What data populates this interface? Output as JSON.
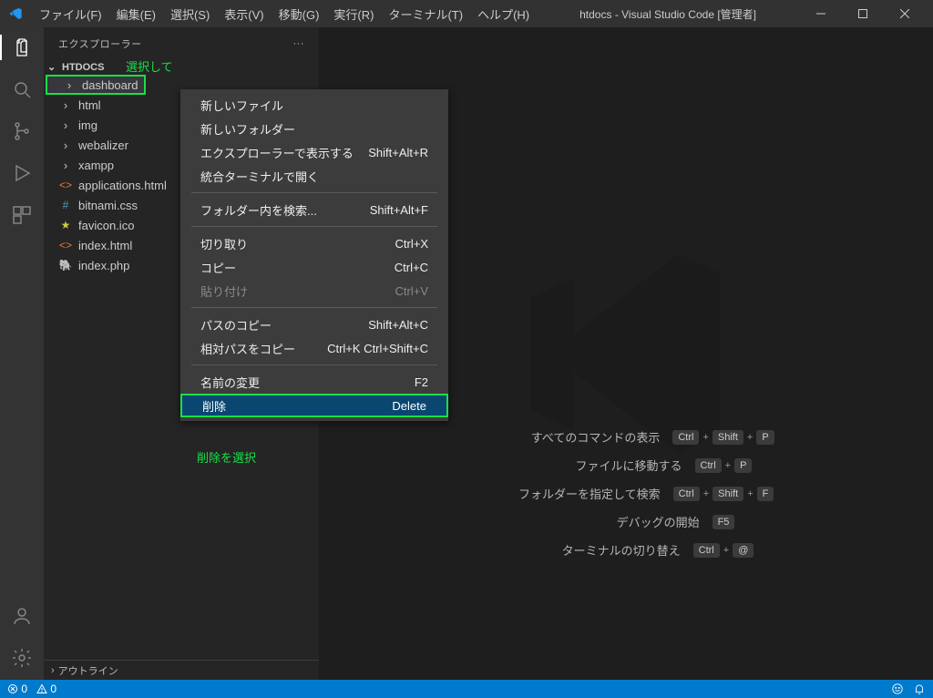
{
  "titlebar": {
    "title": "htdocs - Visual Studio Code [管理者]"
  },
  "menubar": {
    "file": "ファイル(F)",
    "edit": "編集(E)",
    "select": "選択(S)",
    "view": "表示(V)",
    "go": "移動(G)",
    "run": "実行(R)",
    "terminal": "ターミナル(T)",
    "help": "ヘルプ(H)"
  },
  "sidebar": {
    "title": "エクスプローラー",
    "project": "HTDOCS",
    "tree": {
      "dashboard": "dashboard",
      "html": "html",
      "img": "img",
      "webalizer": "webalizer",
      "xampp": "xampp",
      "applications": "applications.html",
      "bitnami": "bitnami.css",
      "favicon": "favicon.ico",
      "indexhtml": "index.html",
      "indexphp": "index.php"
    },
    "outline": "アウトライン"
  },
  "annotations": {
    "select": "選択して",
    "delete": "削除を選択"
  },
  "context": {
    "newfile": "新しいファイル",
    "newfolder": "新しいフォルダー",
    "reveal": "エクスプローラーで表示する",
    "reveal_kb": "Shift+Alt+R",
    "terminal": "統合ターミナルで開く",
    "find": "フォルダー内を検索...",
    "find_kb": "Shift+Alt+F",
    "cut": "切り取り",
    "cut_kb": "Ctrl+X",
    "copy": "コピー",
    "copy_kb": "Ctrl+C",
    "paste": "貼り付け",
    "paste_kb": "Ctrl+V",
    "copypath": "パスのコピー",
    "copypath_kb": "Shift+Alt+C",
    "copyrel": "相対パスをコピー",
    "copyrel_kb": "Ctrl+K Ctrl+Shift+C",
    "rename": "名前の変更",
    "rename_kb": "F2",
    "delete": "削除",
    "delete_kb": "Delete"
  },
  "welcome": {
    "showall": "すべてのコマンドの表示",
    "showall_kb": [
      "Ctrl",
      "+",
      "Shift",
      "+",
      "P"
    ],
    "gotofile": "ファイルに移動する",
    "gotofile_kb": [
      "Ctrl",
      "+",
      "P"
    ],
    "findfolder": "フォルダーを指定して検索",
    "findfolder_kb": [
      "Ctrl",
      "+",
      "Shift",
      "+",
      "F"
    ],
    "debug": "デバッグの開始",
    "debug_kb": [
      "F5"
    ],
    "toggleterm": "ターミナルの切り替え",
    "toggleterm_kb": [
      "Ctrl",
      "+",
      "@"
    ]
  },
  "statusbar": {
    "errors": "0",
    "warnings": "0"
  }
}
